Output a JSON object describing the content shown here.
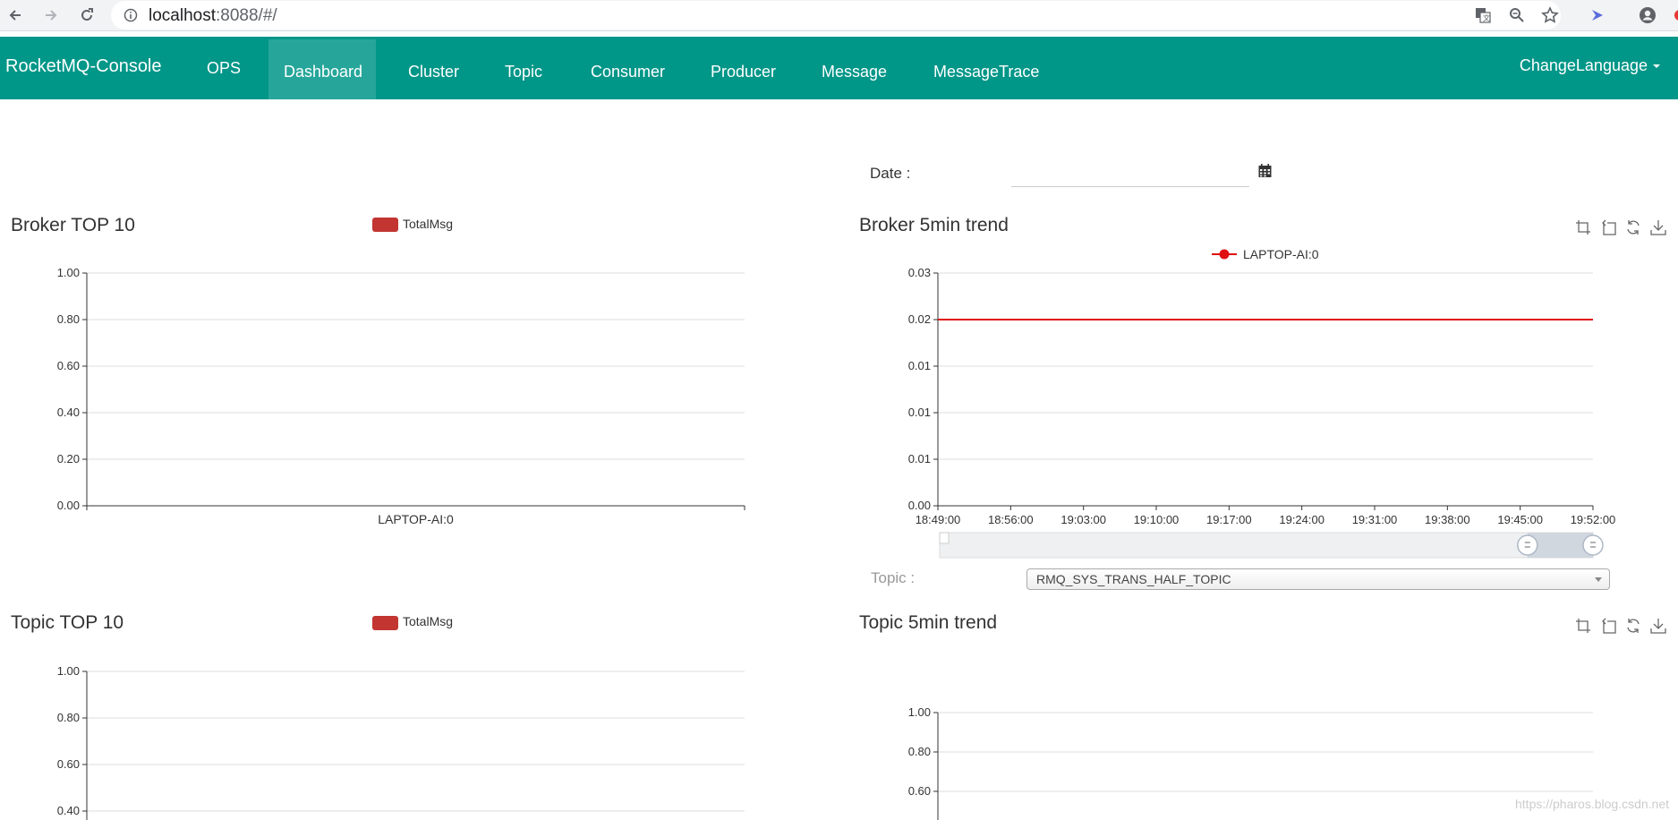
{
  "browser": {
    "url_host": "localhost",
    "url_rest": ":8088/#/"
  },
  "navbar": {
    "brand": "RocketMQ-Console",
    "items": [
      {
        "label": "OPS"
      },
      {
        "label": "Dashboard",
        "active": true
      },
      {
        "label": "Cluster"
      },
      {
        "label": "Topic"
      },
      {
        "label": "Consumer"
      },
      {
        "label": "Producer"
      },
      {
        "label": "Message"
      },
      {
        "label": "MessageTrace"
      }
    ],
    "change_language": "ChangeLanguage"
  },
  "filters": {
    "date_label": "Date :",
    "date_value": "",
    "topic_label": "Topic :",
    "topic_selected": "RMQ_SYS_TRANS_HALF_TOPIC"
  },
  "panels": {
    "broker_top": {
      "title": "Broker TOP 10",
      "legend": "TotalMsg"
    },
    "broker_trend": {
      "title": "Broker 5min trend",
      "legend": "LAPTOP-AI:0"
    },
    "topic_top": {
      "title": "Topic TOP 10",
      "legend": "TotalMsg"
    },
    "topic_trend": {
      "title": "Topic 5min trend"
    }
  },
  "colors": {
    "navbar": "#009688",
    "navbar_active": "#26a69a",
    "series_red": "#c23531",
    "trend_line": "#e01010"
  },
  "watermark": "https://pharos.blog.csdn.net",
  "chart_data": [
    {
      "type": "bar",
      "title": "Broker TOP 10",
      "categories": [
        "LAPTOP-AI:0"
      ],
      "series": [
        {
          "name": "TotalMsg",
          "values": [
            0
          ]
        }
      ],
      "ylim": [
        0,
        1
      ],
      "yticks": [
        "0.00",
        "0.20",
        "0.40",
        "0.60",
        "0.80",
        "1.00"
      ],
      "grid": true,
      "legend": "top-center"
    },
    {
      "type": "line",
      "title": "Broker 5min trend",
      "x": [
        "18:49:00",
        "18:56:00",
        "19:03:00",
        "19:10:00",
        "19:17:00",
        "19:24:00",
        "19:31:00",
        "19:38:00",
        "19:45:00",
        "19:52:00"
      ],
      "series": [
        {
          "name": "LAPTOP-AI:0",
          "values": [
            0.024,
            0.024,
            0.024,
            0.024,
            0.024,
            0.024,
            0.024,
            0.024,
            0.024,
            0.024
          ]
        }
      ],
      "ylim": [
        0,
        0.03
      ],
      "yticks": [
        "0.00",
        "0.01",
        "0.01",
        "0.01",
        "0.02",
        "0.03"
      ],
      "grid": true,
      "legend": "top-center",
      "datazoom_range": [
        0.9,
        1.0
      ]
    },
    {
      "type": "bar",
      "title": "Topic TOP 10",
      "categories": [],
      "series": [
        {
          "name": "TotalMsg",
          "values": []
        }
      ],
      "ylim": [
        0,
        1
      ],
      "yticks_visible": [
        "0.40",
        "0.60",
        "0.80",
        "1.00"
      ],
      "grid": true,
      "legend": "top-center"
    },
    {
      "type": "line",
      "title": "Topic 5min trend",
      "x": [],
      "series": [],
      "ylim": [
        0,
        1
      ],
      "yticks_visible": [
        "0.60",
        "0.80",
        "1.00"
      ],
      "grid": true
    }
  ]
}
